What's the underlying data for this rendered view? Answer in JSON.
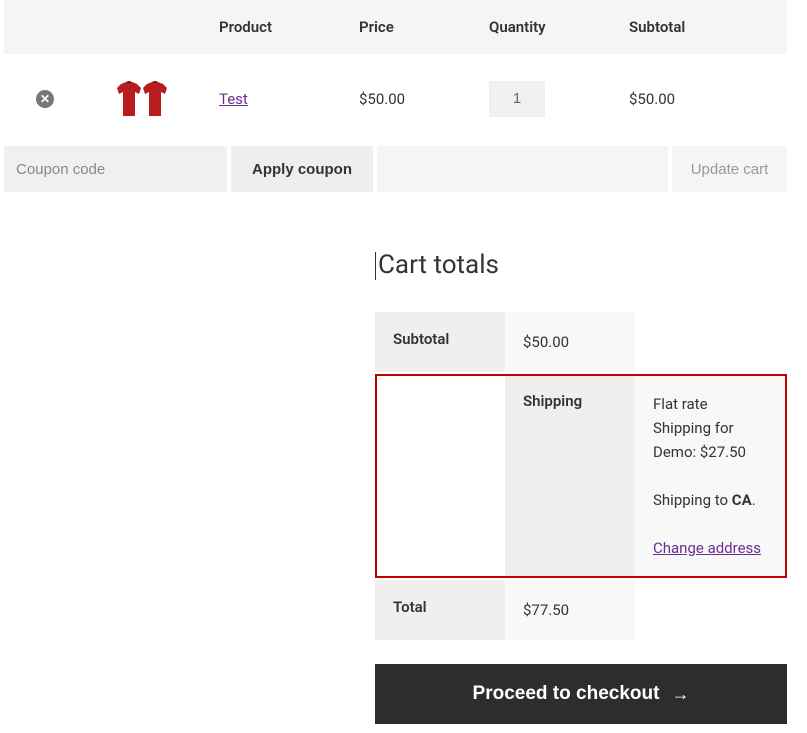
{
  "table": {
    "headers": {
      "product": "Product",
      "price": "Price",
      "quantity": "Quantity",
      "subtotal": "Subtotal"
    },
    "items": [
      {
        "name": "Test",
        "price": "$50.00",
        "quantity": "1",
        "subtotal": "$50.00"
      }
    ]
  },
  "coupon": {
    "placeholder": "Coupon code",
    "apply_label": "Apply coupon",
    "update_label": "Update cart"
  },
  "totals": {
    "title": "Cart totals",
    "subtotal_label": "Subtotal",
    "subtotal_value": "$50.00",
    "shipping_label": "Shipping",
    "shipping_method": "Flat rate Shipping for Demo: $27.50",
    "shipping_to_prefix": "Shipping to ",
    "shipping_to_location": "CA",
    "shipping_to_suffix": ".",
    "change_address": "Change address",
    "total_label": "Total",
    "total_value": "$77.50"
  },
  "checkout": {
    "label": "Proceed to checkout"
  }
}
